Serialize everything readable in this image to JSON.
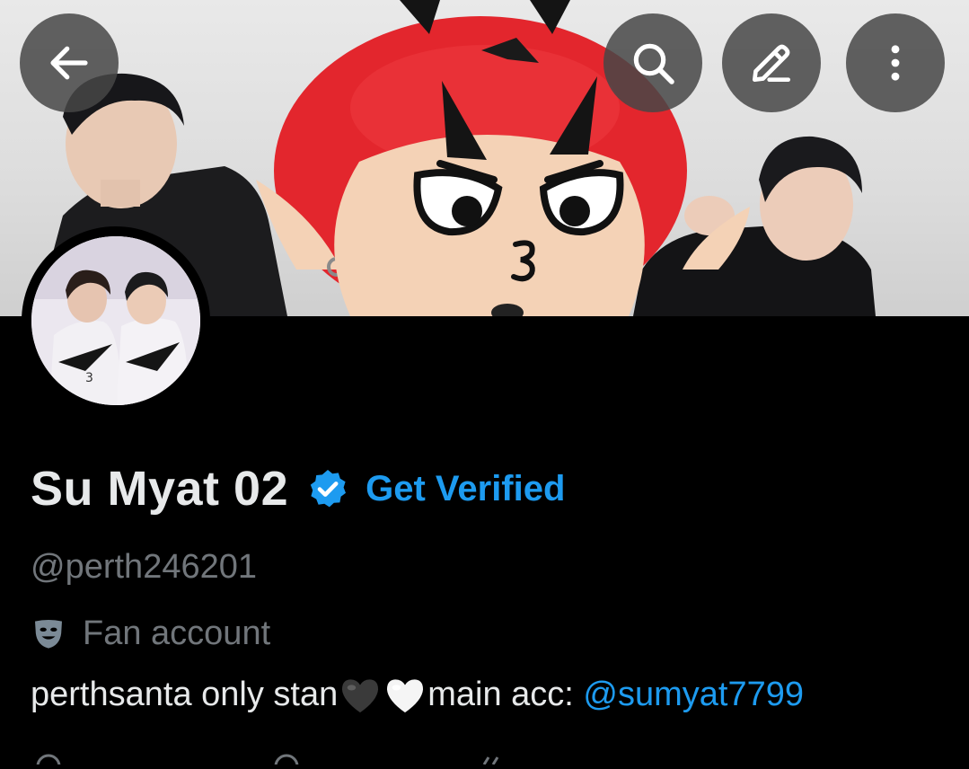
{
  "header": {
    "back_icon": "arrow-left-icon",
    "search_icon": "search-icon",
    "edit_icon": "pencil-icon",
    "more_icon": "more-vertical-icon"
  },
  "profile": {
    "display_name": "Su Myat 02",
    "get_verified_label": "Get Verified",
    "handle": "@perth246201",
    "category_icon": "theater-masks-icon",
    "category": "Fan account",
    "bio_text": "perthsanta only stan",
    "bio_hearts": [
      "black-heart-emoji",
      "white-heart-emoji"
    ],
    "bio_main_acc_label": "main acc: ",
    "bio_mention": "@sumyat7799"
  },
  "colors": {
    "accent": "#1d9bf0",
    "background": "#000000",
    "primary_text": "#e7e9ea",
    "secondary_text": "#71767b",
    "banner_red": "#e3262d"
  }
}
